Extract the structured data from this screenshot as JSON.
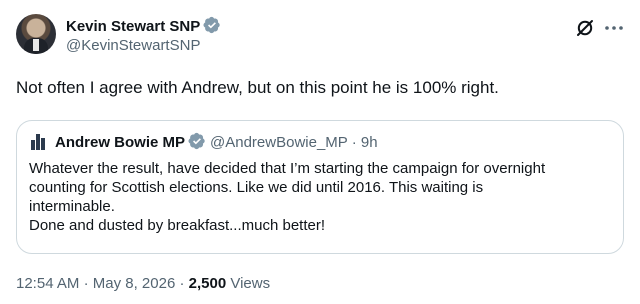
{
  "author": {
    "name": "Kevin Stewart SNP",
    "handle": "@KevinStewartSNP"
  },
  "tweet": {
    "text": "Not often I agree with Andrew, but on this point he is 100% right."
  },
  "quoted": {
    "name": "Andrew Bowie MP",
    "handle": "@AndrewBowie_MP",
    "separator": "·",
    "age": "9h",
    "lines": [
      "Whatever the result, have decided that I’m starting the campaign for overnight",
      "counting for Scottish elections. Like we did until 2016. This waiting is",
      "interminable.",
      "Done and dusted by breakfast...much better!"
    ]
  },
  "meta": {
    "time": "12:54 AM",
    "sep1": "·",
    "date": "May 8, 2026",
    "sep2": "·",
    "views_count": "2,500",
    "views_label": "Views"
  },
  "icons": {
    "verified": "verified-badge-icon",
    "grok": "grok-icon",
    "more": "more-icon"
  },
  "colors": {
    "verified_badge": "#829aab",
    "secondary_text": "#536471",
    "primary_text": "#0f1419",
    "border": "#cfd9de"
  }
}
